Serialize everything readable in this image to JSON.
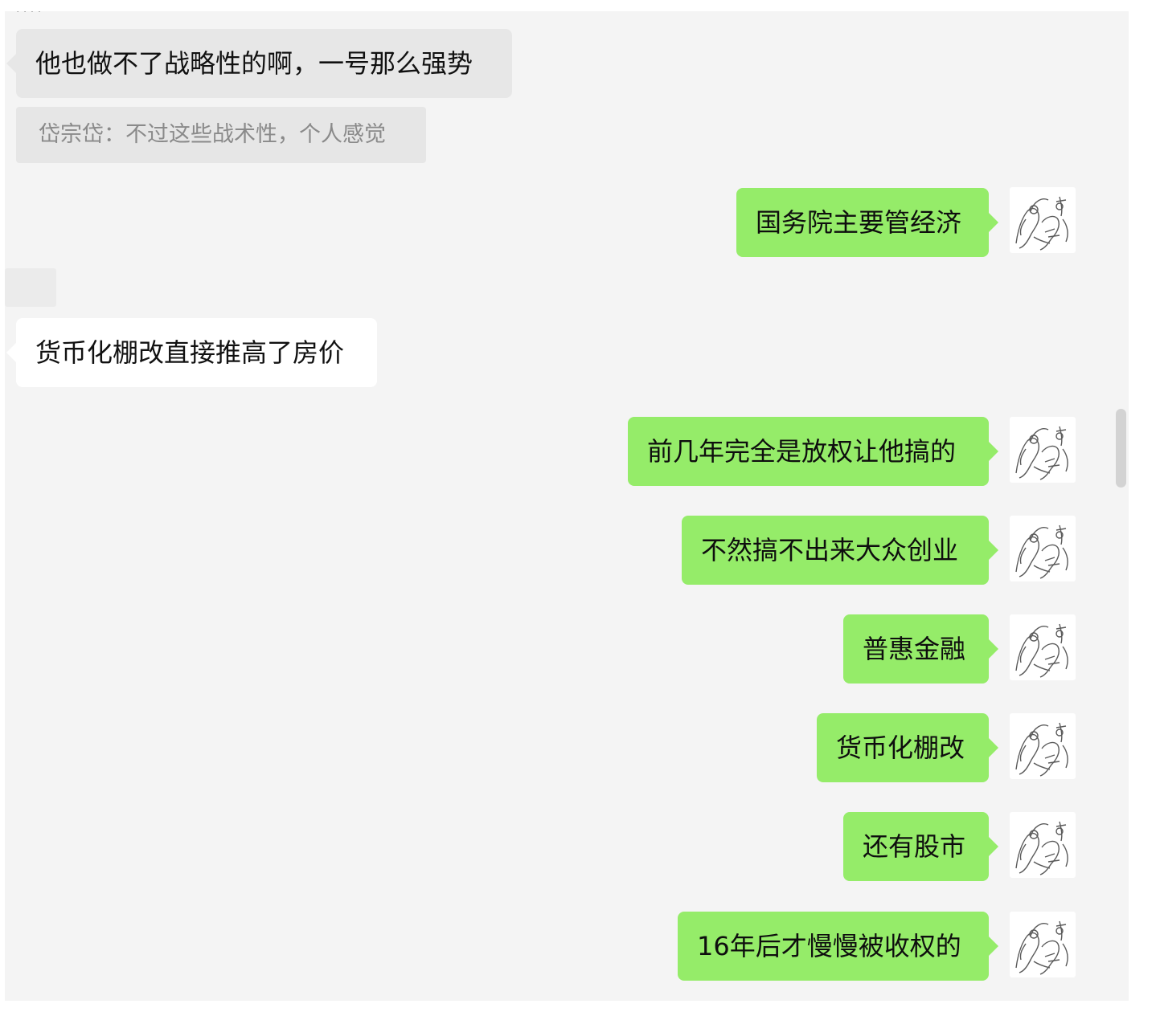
{
  "chat": {
    "incoming": [
      {
        "text": "他也做不了战略性的啊，一号那么强势"
      },
      {
        "text": "货币化棚改直接推高了房价"
      }
    ],
    "quote": {
      "text": "岱宗岱：不过这些战术性，个人感觉"
    },
    "outgoing": [
      {
        "text": "国务院主要管经济"
      },
      {
        "text": "前几年完全是放权让他搞的"
      },
      {
        "text": "不然搞不出来大众创业"
      },
      {
        "text": "普惠金融"
      },
      {
        "text": "货币化棚改"
      },
      {
        "text": "还有股市"
      },
      {
        "text": "16年后才慢慢被收权的"
      }
    ],
    "avatar_icon": "sketch-figure-avatar",
    "colors": {
      "background": "#f4f4f4",
      "outgoing_bubble": "#95ec69",
      "incoming_bubble": "#e7e7e7",
      "incoming_bubble_white": "#ffffff",
      "quote_text": "#8a8a8a"
    }
  }
}
